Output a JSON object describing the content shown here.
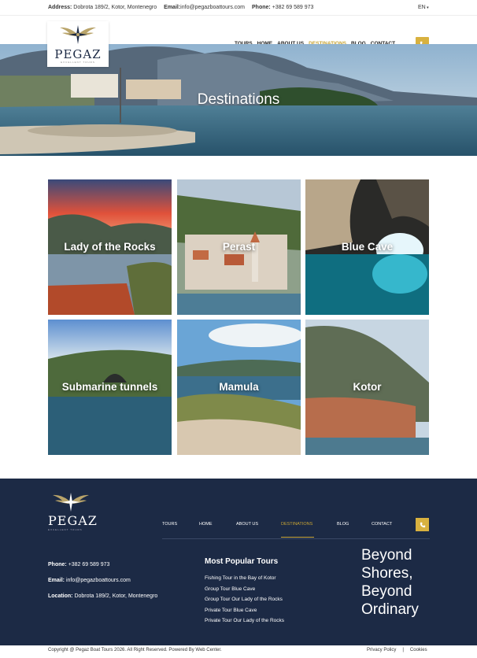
{
  "topbar": {
    "address_label": "Address:",
    "address": "Dobrota 189/2, Kotor, Montenegro",
    "email_label": "Email:",
    "email": "info@pegazboattours.com",
    "phone_label": "Phone:",
    "phone": "+382 69 589 973",
    "lang": "EN"
  },
  "brand": {
    "name": "PEGAZ",
    "tagline": "EXCELLENT TOURS",
    "footer_tagline": "EXCELLENT TOURS"
  },
  "nav": {
    "items": [
      "TOURS",
      "HOME",
      "ABOUT US",
      "DESTINATIONS",
      "BLOG",
      "CONTACT"
    ],
    "active": "DESTINATIONS"
  },
  "hero": {
    "title": "Destinations"
  },
  "destinations": [
    {
      "name": "Lady of the Rocks"
    },
    {
      "name": "Perast"
    },
    {
      "name": "Blue Cave"
    },
    {
      "name": "Submarine tunnels"
    },
    {
      "name": "Mamula"
    },
    {
      "name": "Kotor"
    }
  ],
  "footer": {
    "nav": [
      "TOURS",
      "HOME",
      "ABOUT US",
      "DESTINATIONS",
      "BLOG",
      "CONTACT"
    ],
    "phone_label": "Phone:",
    "phone": "+382 69 589 973",
    "email_label": "Email:",
    "email": "info@pegazboattours.com",
    "location_label": "Location:",
    "location": "Dobrota 189/2, Kotor, Montenegro",
    "popular_title": "Most Popular Tours",
    "popular_tours": [
      "Fishing Tour in the Bay of Kotor",
      "Group Tour Blue Cave",
      "Group Tour Our Lady of the Rocks",
      "Private Tour Blue Cave",
      "Private Tour Our Lady of the Rocks"
    ],
    "slogan": [
      "Beyond",
      "Shores,",
      "Beyond",
      "Ordinary"
    ]
  },
  "bottom": {
    "copyright": "Copyright @ Pegaz Boat Tours 2026. All Right Reserved. Powered By Web Center.",
    "privacy": "Privacy Policy",
    "separator": "|",
    "cookies": "Cookies"
  },
  "colors": {
    "accent": "#d8b13f",
    "footer_bg": "#1c2a45",
    "active_nav": "#c8a434"
  }
}
